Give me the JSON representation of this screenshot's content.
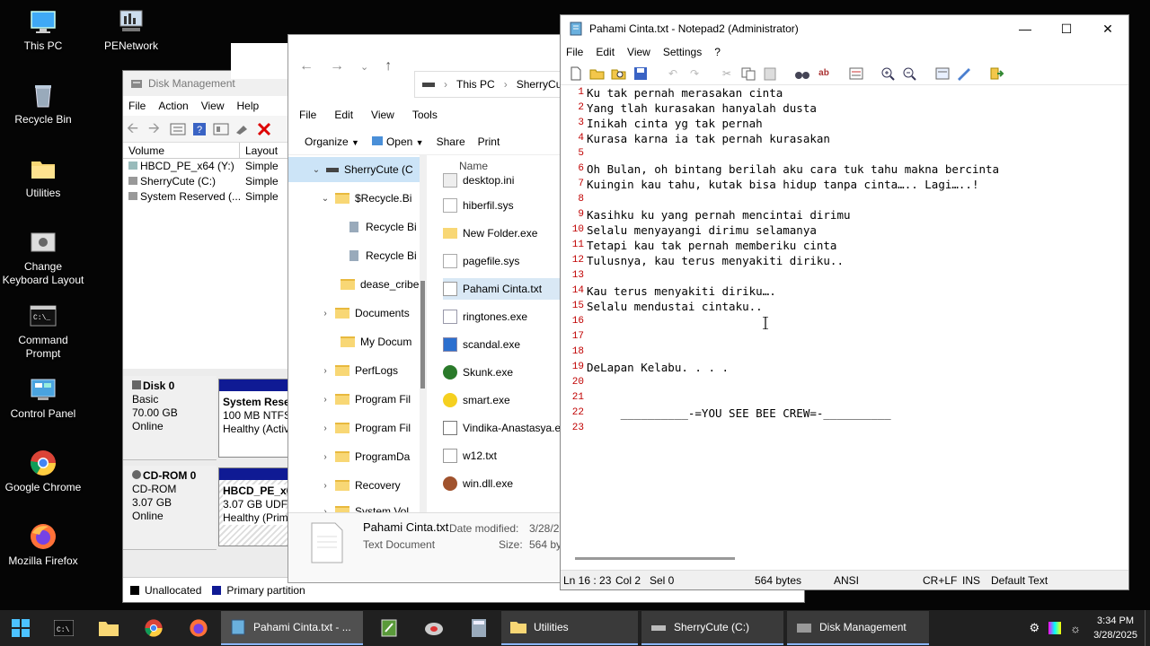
{
  "desktop_icons": [
    {
      "label": "This PC",
      "icon": "this-pc-icon"
    },
    {
      "label": "PENetwork",
      "icon": "network-icon"
    },
    {
      "label": "Recycle Bin",
      "icon": "recycle-bin-icon"
    },
    {
      "label": "Utilities",
      "icon": "folder-icon"
    },
    {
      "label": "Change Keyboard Layout",
      "icon": "keyboard-icon"
    },
    {
      "label": "Command Prompt",
      "icon": "cmd-icon"
    },
    {
      "label": "Control Panel",
      "icon": "control-panel-icon"
    },
    {
      "label": "Google Chrome",
      "icon": "chrome-icon"
    },
    {
      "label": "Mozilla Firefox",
      "icon": "firefox-icon"
    }
  ],
  "disk_management": {
    "title": "Disk Management",
    "menu": [
      "File",
      "Action",
      "View",
      "Help"
    ],
    "columns": [
      "Volume",
      "Layout"
    ],
    "volumes": [
      {
        "name": "HBCD_PE_x64 (Y:)",
        "layout": "Simple"
      },
      {
        "name": "SherryCute (C:)",
        "layout": "Simple"
      },
      {
        "name": "System Reserved (...",
        "layout": "Simple"
      }
    ],
    "disks": [
      {
        "name": "Disk 0",
        "type": "Basic",
        "size": "70.00 GB",
        "status": "Online",
        "partition": {
          "name": "System Rese",
          "size": "100 MB NTFS",
          "health": "Healthy (Activ"
        }
      },
      {
        "name": "CD-ROM 0",
        "type": "CD-ROM",
        "size": "3.07 GB",
        "status": "Online",
        "partition": {
          "name": "HBCD_PE_x6",
          "size": "3.07 GB UDF",
          "health": "Healthy (Prim"
        }
      }
    ],
    "legend": [
      {
        "label": "Unallocated",
        "color": "#000000"
      },
      {
        "label": "Primary partition",
        "color": "#0f1a94"
      }
    ]
  },
  "explorer": {
    "address": [
      "This PC",
      "SherryCute"
    ],
    "menu": [
      "File",
      "Edit",
      "View",
      "Tools"
    ],
    "commands": {
      "organize": "Organize",
      "open": "Open",
      "share": "Share",
      "print": "Print"
    },
    "tree": [
      {
        "label": "SherryCute (C",
        "expanded": true
      },
      {
        "label": "$Recycle.Bi",
        "expanded": true
      },
      {
        "label": "Recycle Bi"
      },
      {
        "label": "Recycle Bi"
      },
      {
        "label": "dease_cribe"
      },
      {
        "label": "Documents"
      },
      {
        "label": "My Docum"
      },
      {
        "label": "PerfLogs"
      },
      {
        "label": "Program Fil"
      },
      {
        "label": "Program Fil"
      },
      {
        "label": "ProgramDa"
      },
      {
        "label": "Recovery"
      },
      {
        "label": "System Vol"
      }
    ],
    "name_header": "Name",
    "files": [
      {
        "name": "desktop.ini"
      },
      {
        "name": "hiberfil.sys"
      },
      {
        "name": "New Folder.exe"
      },
      {
        "name": "pagefile.sys"
      },
      {
        "name": "Pahami Cinta.txt",
        "selected": true
      },
      {
        "name": "ringtones.exe"
      },
      {
        "name": "scandal.exe"
      },
      {
        "name": "Skunk.exe"
      },
      {
        "name": "smart.exe"
      },
      {
        "name": "Vindika-Anastasya.e"
      },
      {
        "name": "w12.txt"
      },
      {
        "name": "win.dll.exe"
      }
    ],
    "details": {
      "file_name": "Pahami Cinta.txt",
      "file_type": "Text Document",
      "date_label": "Date modified:",
      "date_value": "3/28/2",
      "size_label": "Size:",
      "size_value": "564 by"
    }
  },
  "notepad": {
    "title": "Pahami Cinta.txt - Notepad2 (Administrator)",
    "menu": [
      "File",
      "Edit",
      "View",
      "Settings",
      "?"
    ],
    "lines": [
      "Ku tak pernah merasakan cinta",
      "Yang tlah kurasakan hanyalah dusta",
      "Inikah cinta yg tak pernah",
      "Kurasa karna ia tak pernah kurasakan",
      "",
      "Oh Bulan, oh bintang berilah aku cara tuk tahu makna bercinta",
      "Kuingin kau tahu, kutak bisa hidup tanpa cinta….. Lagi…..!",
      "",
      "Kasihku ku yang pernah mencintai dirimu",
      "Selalu menyayangi dirimu selamanya",
      "Tetapi kau tak pernah memberiku cinta",
      "Tulusnya, kau terus menyakiti diriku..",
      "",
      "Kau terus menyakiti diriku….",
      "Selalu mendustai cintaku..",
      "",
      "",
      "",
      "DeLapan Kelabu. . . .",
      "",
      "",
      "     __________-=YOU SEE BEE CREW=-__________",
      ""
    ],
    "status": {
      "position": "Ln 16 : 23",
      "col": "Col 2",
      "sel": "Sel 0",
      "size": "564 bytes",
      "encoding": "ANSI",
      "eol": "CR+LF",
      "mode": "INS",
      "scheme": "Default Text"
    }
  },
  "taskbar": {
    "apps": [
      {
        "label": "Pahami Cinta.txt - ...",
        "active": true
      },
      {
        "label": "Utilities"
      },
      {
        "label": "SherryCute (C:)"
      },
      {
        "label": "Disk Management"
      }
    ],
    "time": "3:34 PM",
    "date": "3/28/2025"
  }
}
